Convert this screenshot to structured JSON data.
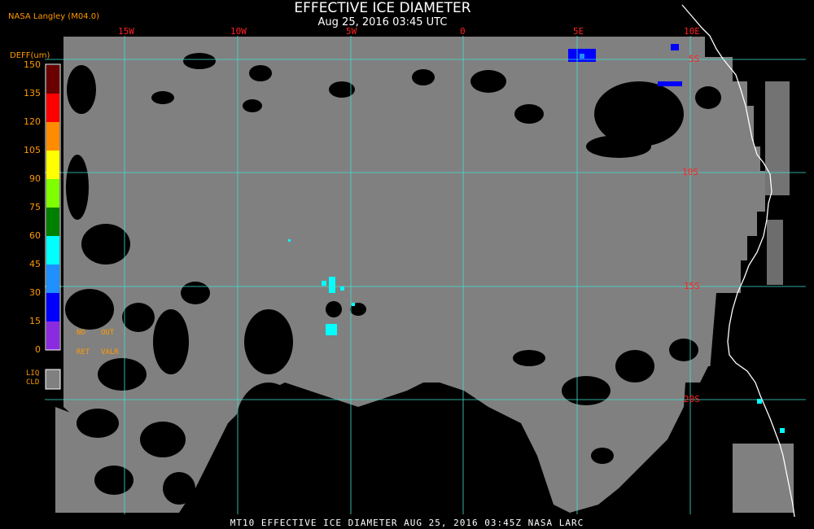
{
  "header": {
    "title": "EFFECTIVE ICE DIAMETER",
    "subtitle": "Aug 25, 2016 03:45 UTC",
    "producer": "NASA Langley (M04.0)"
  },
  "legend": {
    "title": "DEFF(um)",
    "ticks": [
      "150",
      "135",
      "120",
      "105",
      "90",
      "75",
      "60",
      "45",
      "30",
      "15",
      "0"
    ],
    "colors": [
      "#6b0000",
      "#ff0000",
      "#ff8c00",
      "#ffff00",
      "#7fff00",
      "#008000",
      "#00ffff",
      "#1e90ff",
      "#0000ff",
      "#8a2be2"
    ],
    "no_ret_labels": [
      "NO",
      "OUT",
      "RET",
      "VALR"
    ],
    "liq_cld_label": [
      "LIQ",
      "CLD"
    ],
    "liq_cld_color": "#808080"
  },
  "map": {
    "longitude_labels": [
      "15W",
      "10W",
      "5W",
      "0",
      "5E",
      "10E"
    ],
    "latitude_labels": [
      "5S",
      "10S",
      "15S",
      "20S"
    ],
    "grid_color": "#40e0d0",
    "coast_color": "#ffffff",
    "cloud_color": "#808080",
    "ice_cloud_colors": [
      "#0000ff",
      "#00ffff",
      "#1e90ff"
    ]
  },
  "footer": {
    "text": "MT10  EFFECTIVE ICE DIAMETER   AUG 25, 2016 03:45Z   NASA LARC"
  }
}
